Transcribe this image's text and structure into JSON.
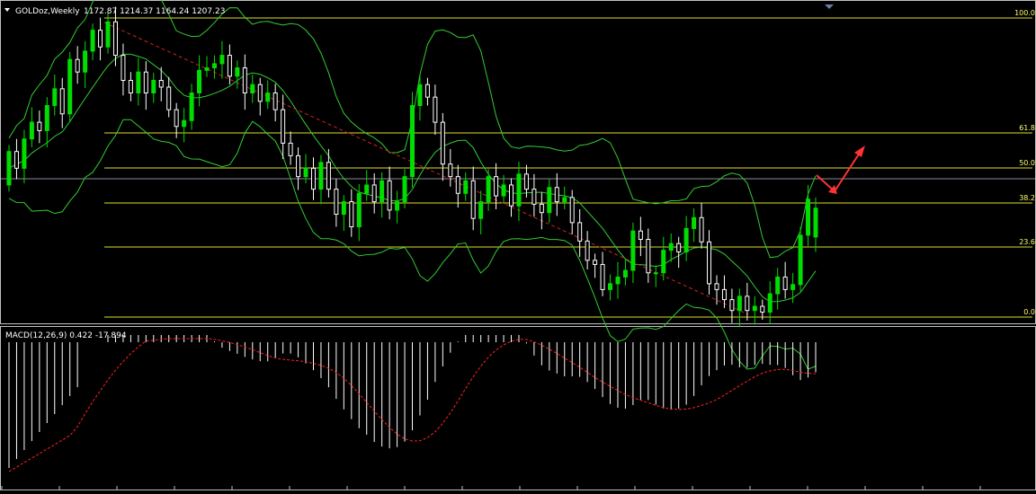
{
  "main_panel": {
    "symbol_label": "GOLDoz,Weekly",
    "ohlc": "1172.87 1214.37 1164.24 1207.23"
  },
  "fibonacci": {
    "levels": [
      {
        "label": "100.0"
      },
      {
        "label": "61.8"
      },
      {
        "label": "50.0"
      },
      {
        "label": "38.2"
      },
      {
        "label": "23.6"
      },
      {
        "label": "0.0"
      }
    ],
    "color": "#ffff00"
  },
  "macd_panel": {
    "label": "MACD(12,26,9) 0.422 -17.894"
  },
  "colors": {
    "background": "#000000",
    "bull_candle": "#00dd00",
    "bear_candle": "#ffffff",
    "bands": "#33cc33",
    "trendline": "#cc2222",
    "arrow": "#ff3333",
    "macd_hist": "#ffffff",
    "macd_signal": "#ff2222",
    "panel_border": "#c0c0c0"
  },
  "chart_data": {
    "type": "candlestick",
    "title": "GOLDoz,Weekly",
    "series": [
      {
        "name": "Price",
        "values": [
          {
            "o": 1235,
            "c": 1275
          },
          {
            "o": 1275,
            "c": 1255
          },
          {
            "o": 1255,
            "c": 1290
          },
          {
            "o": 1290,
            "c": 1310
          },
          {
            "o": 1310,
            "c": 1300
          },
          {
            "o": 1300,
            "c": 1330
          },
          {
            "o": 1330,
            "c": 1350
          },
          {
            "o": 1350,
            "c": 1320
          },
          {
            "o": 1320,
            "c": 1385
          },
          {
            "o": 1385,
            "c": 1370
          },
          {
            "o": 1370,
            "c": 1395
          },
          {
            "o": 1395,
            "c": 1420
          },
          {
            "o": 1420,
            "c": 1400
          },
          {
            "o": 1400,
            "c": 1430
          },
          {
            "o": 1430,
            "c": 1390
          },
          {
            "o": 1390,
            "c": 1360
          },
          {
            "o": 1360,
            "c": 1345
          },
          {
            "o": 1345,
            "c": 1370
          },
          {
            "o": 1370,
            "c": 1345
          },
          {
            "o": 1345,
            "c": 1360
          },
          {
            "o": 1360,
            "c": 1352
          },
          {
            "o": 1352,
            "c": 1325
          },
          {
            "o": 1325,
            "c": 1305
          },
          {
            "o": 1305,
            "c": 1312
          },
          {
            "o": 1312,
            "c": 1345
          },
          {
            "o": 1345,
            "c": 1372
          },
          {
            "o": 1372,
            "c": 1375
          },
          {
            "o": 1375,
            "c": 1380
          },
          {
            "o": 1380,
            "c": 1390
          },
          {
            "o": 1390,
            "c": 1365
          },
          {
            "o": 1365,
            "c": 1375
          },
          {
            "o": 1375,
            "c": 1345
          },
          {
            "o": 1345,
            "c": 1355
          },
          {
            "o": 1355,
            "c": 1335
          },
          {
            "o": 1335,
            "c": 1345
          },
          {
            "o": 1345,
            "c": 1325
          },
          {
            "o": 1325,
            "c": 1285
          },
          {
            "o": 1285,
            "c": 1270
          },
          {
            "o": 1270,
            "c": 1245
          },
          {
            "o": 1245,
            "c": 1255
          },
          {
            "o": 1255,
            "c": 1230
          },
          {
            "o": 1230,
            "c": 1262
          },
          {
            "o": 1262,
            "c": 1230
          },
          {
            "o": 1230,
            "c": 1200
          },
          {
            "o": 1200,
            "c": 1215
          },
          {
            "o": 1215,
            "c": 1185
          },
          {
            "o": 1185,
            "c": 1225
          },
          {
            "o": 1225,
            "c": 1235
          },
          {
            "o": 1235,
            "c": 1215
          },
          {
            "o": 1215,
            "c": 1240
          },
          {
            "o": 1240,
            "c": 1205
          },
          {
            "o": 1205,
            "c": 1215
          },
          {
            "o": 1215,
            "c": 1245
          },
          {
            "o": 1245,
            "c": 1330
          },
          {
            "o": 1330,
            "c": 1355
          },
          {
            "o": 1355,
            "c": 1340
          },
          {
            "o": 1340,
            "c": 1310
          },
          {
            "o": 1310,
            "c": 1260
          },
          {
            "o": 1260,
            "c": 1245
          },
          {
            "o": 1245,
            "c": 1225
          },
          {
            "o": 1225,
            "c": 1240
          },
          {
            "o": 1240,
            "c": 1195
          },
          {
            "o": 1195,
            "c": 1215
          },
          {
            "o": 1215,
            "c": 1245
          },
          {
            "o": 1245,
            "c": 1222
          },
          {
            "o": 1222,
            "c": 1235
          },
          {
            "o": 1235,
            "c": 1210
          },
          {
            "o": 1210,
            "c": 1248
          },
          {
            "o": 1248,
            "c": 1230
          },
          {
            "o": 1230,
            "c": 1212
          },
          {
            "o": 1212,
            "c": 1202
          },
          {
            "o": 1202,
            "c": 1232
          },
          {
            "o": 1232,
            "c": 1215
          },
          {
            "o": 1215,
            "c": 1220
          },
          {
            "o": 1220,
            "c": 1190
          },
          {
            "o": 1190,
            "c": 1168
          },
          {
            "o": 1168,
            "c": 1145
          },
          {
            "o": 1145,
            "c": 1140
          },
          {
            "o": 1140,
            "c": 1110
          },
          {
            "o": 1110,
            "c": 1117
          },
          {
            "o": 1117,
            "c": 1125
          },
          {
            "o": 1125,
            "c": 1133
          },
          {
            "o": 1133,
            "c": 1180
          },
          {
            "o": 1180,
            "c": 1170
          },
          {
            "o": 1170,
            "c": 1130
          },
          {
            "o": 1130,
            "c": 1130
          },
          {
            "o": 1130,
            "c": 1157
          },
          {
            "o": 1157,
            "c": 1165
          },
          {
            "o": 1165,
            "c": 1155
          },
          {
            "o": 1155,
            "c": 1183
          },
          {
            "o": 1183,
            "c": 1196
          },
          {
            "o": 1196,
            "c": 1167
          },
          {
            "o": 1167,
            "c": 1117
          },
          {
            "o": 1117,
            "c": 1110
          },
          {
            "o": 1110,
            "c": 1098
          },
          {
            "o": 1098,
            "c": 1085
          },
          {
            "o": 1085,
            "c": 1102
          },
          {
            "o": 1102,
            "c": 1085
          },
          {
            "o": 1085,
            "c": 1090
          },
          {
            "o": 1090,
            "c": 1083
          },
          {
            "o": 1083,
            "c": 1105
          },
          {
            "o": 1105,
            "c": 1125
          },
          {
            "o": 1125,
            "c": 1110
          },
          {
            "o": 1110,
            "c": 1116
          },
          {
            "o": 1116,
            "c": 1175
          },
          {
            "o": 1175,
            "c": 1218
          },
          {
            "o": 1172.87,
            "c": 1207.23
          }
        ]
      }
    ]
  }
}
